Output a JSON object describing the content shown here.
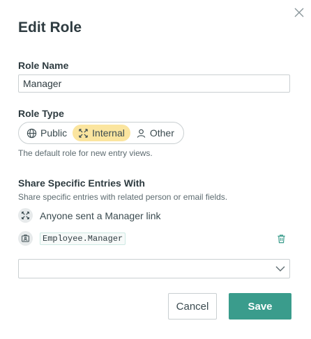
{
  "dialog": {
    "title": "Edit Role",
    "close_icon": "close-icon"
  },
  "role_name": {
    "label": "Role Name",
    "value": "Manager"
  },
  "role_type": {
    "label": "Role Type",
    "options": [
      {
        "label": "Public",
        "icon": "globe-icon",
        "selected": false
      },
      {
        "label": "Internal",
        "icon": "internal-icon",
        "selected": true
      },
      {
        "label": "Other",
        "icon": "person-icon",
        "selected": false
      }
    ],
    "helper": "The default role for new entry views."
  },
  "share": {
    "label": "Share Specific Entries With",
    "helper": "Share specific entries with related person or email fields.",
    "link_text": "Anyone sent a Manager link",
    "field_ref": "Employee.Manager",
    "select_value": ""
  },
  "footer": {
    "cancel_label": "Cancel",
    "save_label": "Save"
  },
  "colors": {
    "accent": "#3a9c8c",
    "selected_bg": "#fbe59f",
    "border": "#c9cfd1"
  }
}
